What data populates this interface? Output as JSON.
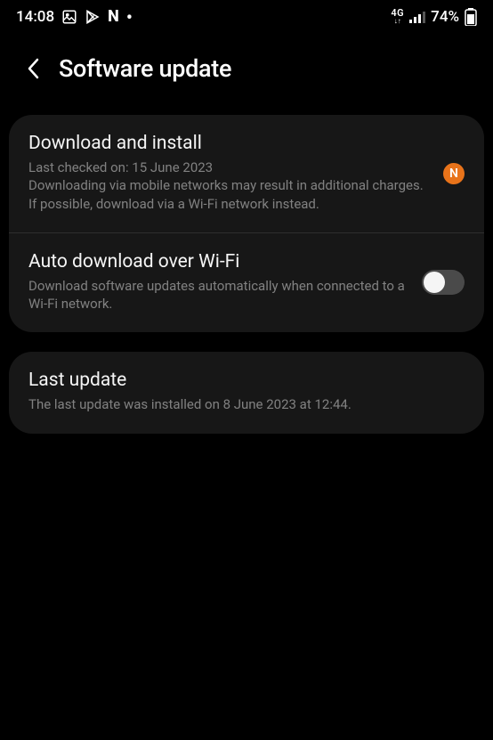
{
  "status": {
    "time": "14:08",
    "network_label": "4G",
    "battery_percent": "74%"
  },
  "header": {
    "title": "Software update"
  },
  "items": {
    "download": {
      "title": "Download and install",
      "sub1": "Last checked on: 15 June 2023",
      "sub2": "Downloading via mobile networks may result in additional charges. If possible, download via a Wi-Fi network instead.",
      "badge": "N"
    },
    "auto": {
      "title": "Auto download over Wi-Fi",
      "sub": "Download software updates automatically when connected to a Wi-Fi network.",
      "toggle_on": false
    },
    "last": {
      "title": "Last update",
      "sub": "The last update was installed on 8 June 2023 at 12:44."
    }
  }
}
